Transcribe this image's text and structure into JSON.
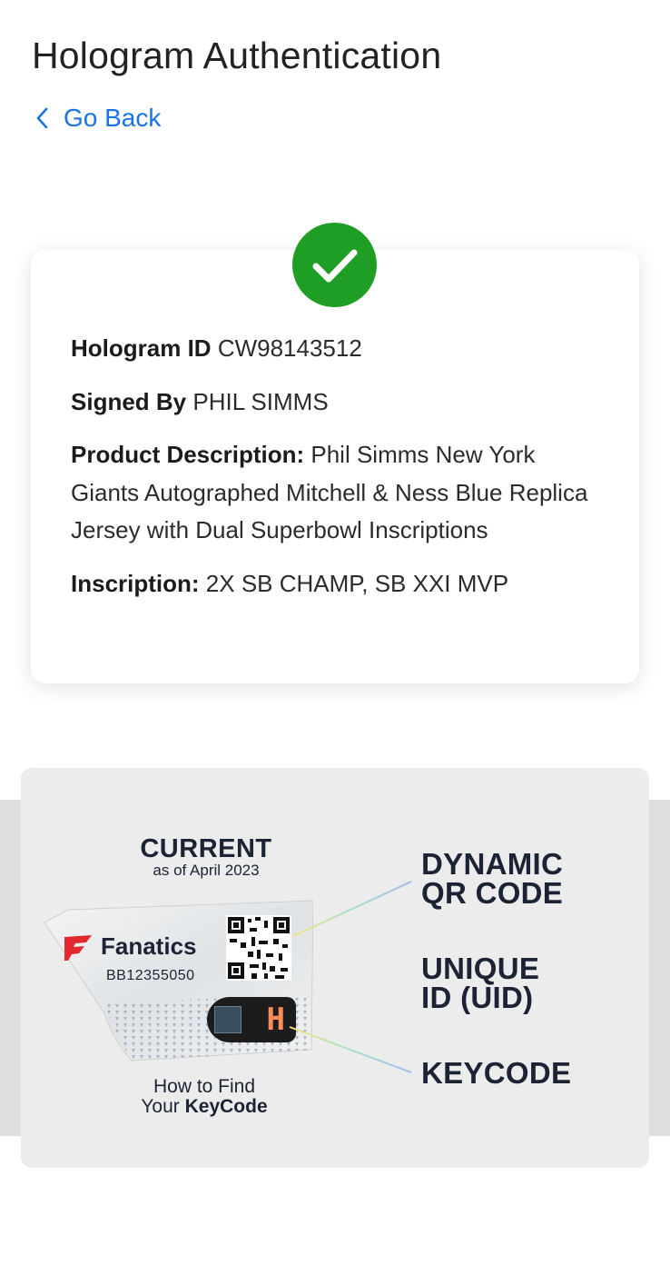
{
  "header": {
    "title": "Hologram Authentication",
    "back_label": "Go Back"
  },
  "status": {
    "icon": "check-icon",
    "color": "#1e9e24"
  },
  "details": {
    "hologram_id_label": "Hologram ID",
    "hologram_id": "CW98143512",
    "signed_by_label": "Signed By",
    "signed_by": "PHIL SIMMS",
    "description_label": "Product Description:",
    "description": "Phil Simms New York Giants Autographed Mitchell & Ness Blue Replica Jersey with Dual Superbowl Inscriptions",
    "inscription_label": "Inscription:",
    "inscription": "2X SB CHAMP, SB XXI MVP"
  },
  "infographic": {
    "current_title": "CURRENT",
    "current_sub": "as of April 2023",
    "brand": "Fanatics",
    "uid_sample": "BB12355050",
    "keycode_char": "H",
    "how_to_line1": "How to Find",
    "how_to_line2_prefix": "Your ",
    "how_to_line2_bold": "KeyCode",
    "label_qr_1": "DYNAMIC",
    "label_qr_2": "QR CODE",
    "label_uid_1": "UNIQUE",
    "label_uid_2": "ID (UID)",
    "label_key": "KEYCODE"
  }
}
